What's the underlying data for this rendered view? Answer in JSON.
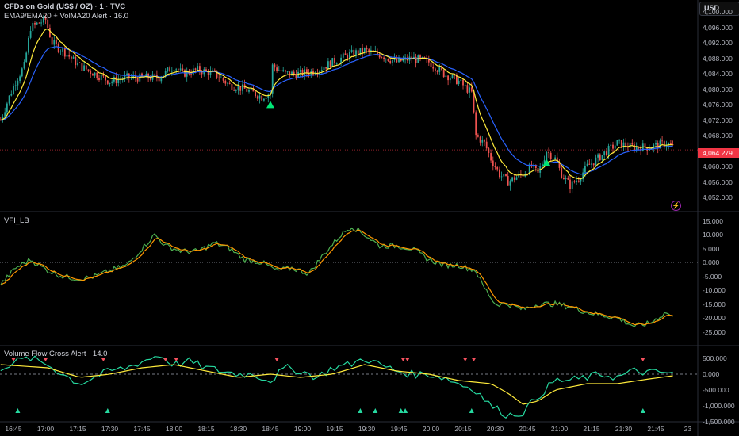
{
  "header": {
    "title": "CFDs on Gold (US$ / OZ) · 1 · TVC",
    "indicator": "EMA9/EMA20 + VolMA20 Alert · 16.0",
    "currency": "USD"
  },
  "chart_data": [
    {
      "type": "candlestick",
      "name": "price",
      "title": "CFDs on Gold (US$ / OZ) · 1 · TVC",
      "ylim": [
        4049,
        4103
      ],
      "y_ticks": [
        "4,100.000",
        "4,096.000",
        "4,092.000",
        "4,088.000",
        "4,084.000",
        "4,080.000",
        "4,076.000",
        "4,072.000",
        "4,068.000",
        "4,060.000",
        "4,056.000",
        "4,052.000"
      ],
      "y_tick_values": [
        4100,
        4096,
        4092,
        4088,
        4084,
        4080,
        4076,
        4072,
        4068,
        4060,
        4056,
        4052
      ],
      "last_price": 4064.279,
      "last_price_label": "4,064.279",
      "note_x": "minutes since 16:45",
      "path": [
        [
          -6,
          4072
        ],
        [
          -2,
          4078
        ],
        [
          1,
          4082
        ],
        [
          5,
          4086
        ],
        [
          8,
          4096
        ],
        [
          15,
          4098
        ],
        [
          18,
          4092
        ],
        [
          23,
          4090
        ],
        [
          31,
          4086
        ],
        [
          38,
          4084
        ],
        [
          45,
          4082
        ],
        [
          53,
          4083
        ],
        [
          60,
          4083
        ],
        [
          68,
          4083
        ],
        [
          75,
          4086
        ],
        [
          79,
          4084
        ],
        [
          86,
          4085
        ],
        [
          94,
          4084
        ],
        [
          101,
          4081
        ],
        [
          108,
          4080
        ],
        [
          116,
          4078
        ],
        [
          120,
          4079
        ],
        [
          121,
          4086
        ],
        [
          127,
          4084
        ],
        [
          134,
          4084
        ],
        [
          142,
          4085
        ],
        [
          149,
          4087
        ],
        [
          157,
          4089
        ],
        [
          164,
          4090
        ],
        [
          171,
          4089
        ],
        [
          179,
          4087
        ],
        [
          186,
          4088
        ],
        [
          194,
          4087
        ],
        [
          201,
          4084
        ],
        [
          208,
          4082
        ],
        [
          214,
          4079
        ],
        [
          216,
          4068
        ],
        [
          220,
          4066
        ],
        [
          223,
          4062
        ],
        [
          227,
          4058
        ],
        [
          231,
          4056
        ],
        [
          234,
          4057
        ],
        [
          238,
          4058
        ],
        [
          242,
          4060
        ],
        [
          245,
          4058
        ],
        [
          249,
          4064
        ],
        [
          253,
          4062
        ],
        [
          256,
          4058
        ],
        [
          260,
          4055
        ],
        [
          264,
          4057
        ],
        [
          268,
          4060
        ],
        [
          275,
          4063
        ],
        [
          282,
          4066
        ],
        [
          290,
          4065
        ],
        [
          297,
          4065
        ],
        [
          305,
          4066
        ],
        [
          308,
          4065
        ]
      ],
      "ema_colors": {
        "ema9": "#ffeb3b",
        "ema20": "#2962ff"
      },
      "buy_signals_minutes": [
        120,
        249
      ]
    },
    {
      "type": "line",
      "name": "VFI_LB",
      "title": "VFI_LB",
      "ylim": [
        -28,
        18
      ],
      "y_ticks": [
        "15.000",
        "10.000",
        "5.000",
        "0.000",
        "-5.000",
        "-10.000",
        "-15.000",
        "-20.000",
        "-25.000"
      ],
      "y_tick_values": [
        15,
        10,
        5,
        0,
        -5,
        -10,
        -15,
        -20,
        -25
      ],
      "series": [
        {
          "name": "VFI",
          "color": "#4caf50",
          "points": [
            [
              -6,
              -8
            ],
            [
              1,
              -2
            ],
            [
              8,
              1
            ],
            [
              16,
              -3
            ],
            [
              23,
              -5
            ],
            [
              31,
              -6
            ],
            [
              38,
              -5
            ],
            [
              45,
              -3
            ],
            [
              53,
              -1
            ],
            [
              60,
              5
            ],
            [
              66,
              10
            ],
            [
              71,
              6
            ],
            [
              79,
              4
            ],
            [
              86,
              4
            ],
            [
              94,
              7
            ],
            [
              101,
              5
            ],
            [
              108,
              1
            ],
            [
              116,
              0
            ],
            [
              123,
              -3
            ],
            [
              130,
              -2
            ],
            [
              138,
              -4
            ],
            [
              145,
              3
            ],
            [
              153,
              10
            ],
            [
              158,
              13
            ],
            [
              164,
              10
            ],
            [
              171,
              6
            ],
            [
              179,
              6
            ],
            [
              186,
              5
            ],
            [
              194,
              1
            ],
            [
              201,
              -1
            ],
            [
              208,
              -1
            ],
            [
              216,
              -3
            ],
            [
              219,
              -8
            ],
            [
              225,
              -15
            ],
            [
              231,
              -15
            ],
            [
              238,
              -17
            ],
            [
              245,
              -15
            ],
            [
              253,
              -15
            ],
            [
              260,
              -16
            ],
            [
              268,
              -18
            ],
            [
              275,
              -19
            ],
            [
              282,
              -20
            ],
            [
              290,
              -23
            ],
            [
              297,
              -22
            ],
            [
              305,
              -18
            ],
            [
              308,
              -20
            ]
          ]
        },
        {
          "name": "Signal",
          "color": "#ff9800"
        }
      ]
    },
    {
      "type": "line",
      "name": "Volume Flow Cross Alert",
      "title": "Volume Flow Cross Alert · 14.0",
      "ylim": [
        -1550000,
        680000
      ],
      "y_ticks": [
        "500.000",
        "0.000",
        "-500.000",
        "-1,000.000",
        "-1,500.000"
      ],
      "y_tick_values": [
        500000,
        0,
        -500000,
        -1000000,
        -1500000
      ],
      "series": [
        {
          "name": "Flow",
          "color": "#26d9a0",
          "points": [
            [
              -6,
              200000
            ],
            [
              1,
              400000
            ],
            [
              8,
              500000
            ],
            [
              16,
              300000
            ],
            [
              23,
              0
            ],
            [
              31,
              -300000
            ],
            [
              38,
              -100000
            ],
            [
              45,
              100000
            ],
            [
              53,
              200000
            ],
            [
              60,
              400000
            ],
            [
              68,
              600000
            ],
            [
              75,
              300000
            ],
            [
              82,
              400000
            ],
            [
              90,
              200000
            ],
            [
              97,
              100000
            ],
            [
              105,
              0
            ],
            [
              112,
              0
            ],
            [
              120,
              -200000
            ],
            [
              127,
              200000
            ],
            [
              134,
              100000
            ],
            [
              142,
              -100000
            ],
            [
              149,
              200000
            ],
            [
              157,
              300000
            ],
            [
              164,
              500000
            ],
            [
              171,
              300000
            ],
            [
              179,
              100000
            ],
            [
              186,
              0
            ],
            [
              194,
              0
            ],
            [
              201,
              -100000
            ],
            [
              208,
              -300000
            ],
            [
              216,
              -500000
            ],
            [
              223,
              -1000000
            ],
            [
              231,
              -1300000
            ],
            [
              238,
              -1200000
            ],
            [
              245,
              -700000
            ],
            [
              253,
              -200000
            ],
            [
              260,
              -200000
            ],
            [
              268,
              -100000
            ],
            [
              275,
              0
            ],
            [
              282,
              -100000
            ],
            [
              290,
              100000
            ],
            [
              297,
              50000
            ],
            [
              305,
              50000
            ],
            [
              308,
              0
            ]
          ]
        },
        {
          "name": "Signal",
          "color": "#ffeb3b",
          "points": [
            [
              -6,
              300000
            ],
            [
              16,
              200000
            ],
            [
              31,
              -100000
            ],
            [
              45,
              0
            ],
            [
              60,
              200000
            ],
            [
              75,
              300000
            ],
            [
              90,
              100000
            ],
            [
              105,
              -100000
            ],
            [
              120,
              0
            ],
            [
              134,
              -100000
            ],
            [
              149,
              0
            ],
            [
              164,
              300000
            ],
            [
              179,
              100000
            ],
            [
              194,
              0
            ],
            [
              208,
              -200000
            ],
            [
              223,
              -300000
            ],
            [
              231,
              -600000
            ],
            [
              238,
              -950000
            ],
            [
              245,
              -850000
            ],
            [
              253,
              -500000
            ],
            [
              268,
              -300000
            ],
            [
              282,
              -300000
            ],
            [
              297,
              -150000
            ],
            [
              308,
              -50000
            ]
          ]
        }
      ],
      "sell_markers_minutes": [
        0,
        15,
        42,
        71,
        76,
        123,
        182,
        184,
        211,
        215,
        294
      ],
      "buy_markers_minutes": [
        2,
        44,
        162,
        169,
        181,
        183,
        214,
        294
      ]
    }
  ],
  "time_axis": {
    "labels": [
      "16:45",
      "17:00",
      "17:15",
      "17:30",
      "17:45",
      "18:00",
      "18:15",
      "18:30",
      "18:45",
      "19:00",
      "19:15",
      "19:30",
      "19:45",
      "20:00",
      "20:15",
      "20:30",
      "20:45",
      "21:00",
      "21:15",
      "21:30",
      "21:45",
      "23"
    ]
  },
  "colors": {
    "up": "#26a69a",
    "down": "#ef5350",
    "bg": "#000000",
    "grid": "#2a2e39"
  }
}
